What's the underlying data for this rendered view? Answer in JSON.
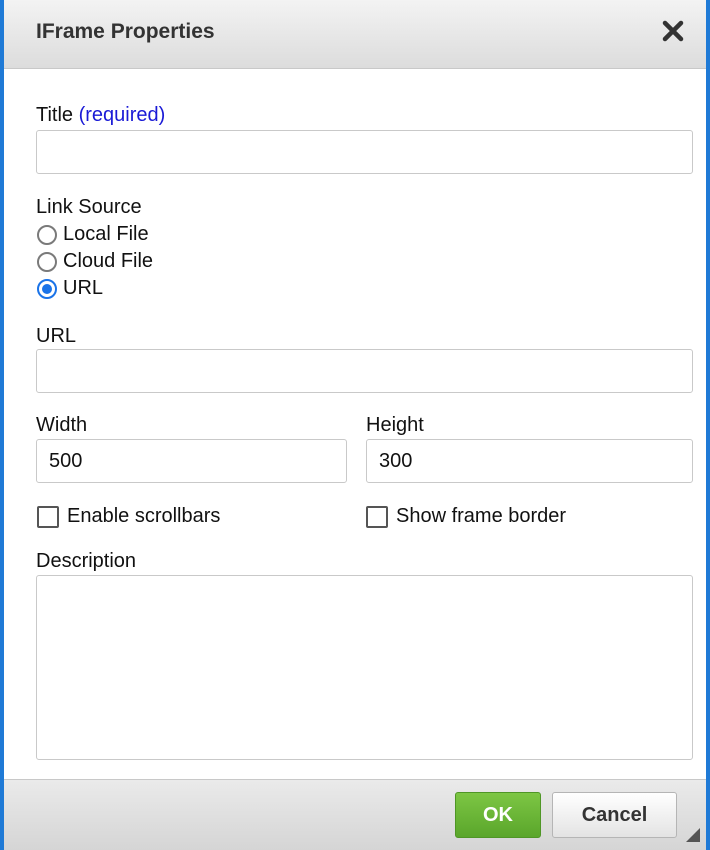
{
  "dialog": {
    "title": "IFrame Properties",
    "close_icon": "close-icon"
  },
  "form": {
    "title_label": "Title",
    "title_required": "(required)",
    "title_value": "",
    "link_source_label": "Link Source",
    "link_source_options": [
      {
        "label": "Local File",
        "checked": false
      },
      {
        "label": "Cloud File",
        "checked": false
      },
      {
        "label": "URL",
        "checked": true
      }
    ],
    "url_label": "URL",
    "url_value": "",
    "width_label": "Width",
    "width_value": "500",
    "height_label": "Height",
    "height_value": "300",
    "enable_scrollbars_label": "Enable scrollbars",
    "enable_scrollbars_checked": false,
    "show_frame_border_label": "Show frame border",
    "show_frame_border_checked": false,
    "description_label": "Description",
    "description_value": ""
  },
  "footer": {
    "ok_label": "OK",
    "cancel_label": "Cancel"
  },
  "colors": {
    "accent": "#1f7ad6",
    "required": "#1a1ad6",
    "ok_button": "#6bb838",
    "radio_checked": "#1a73e8"
  }
}
